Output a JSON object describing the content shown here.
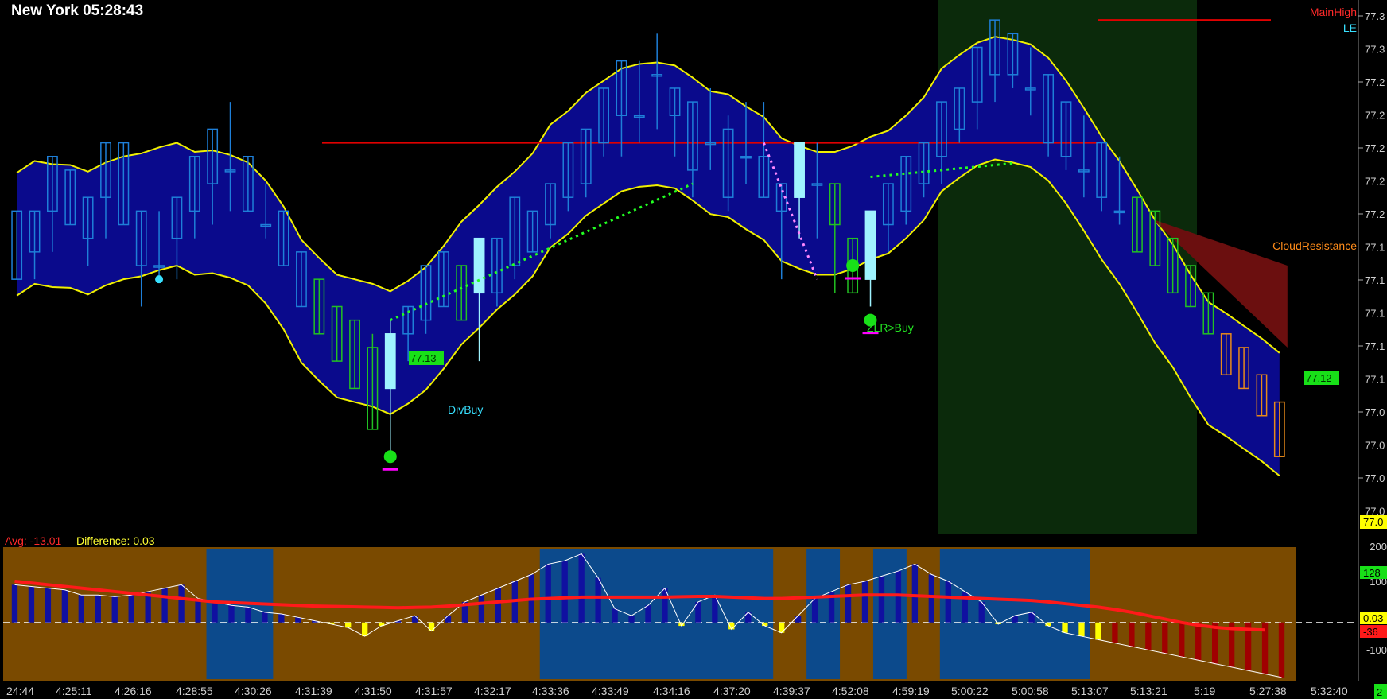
{
  "header": {
    "title": "New York 05:28:43"
  },
  "indicator_header": {
    "avg_label": "Avg: -13.01",
    "diff_label": "Difference: 0.03"
  },
  "colors": {
    "up_bar": "#1e7fd8",
    "down_bar": "#22c222",
    "signal_bar": "#9ff3ff",
    "orange_bar": "#e88a1a",
    "band": "#0a0a8c",
    "band_edge": "#f0f000",
    "resistance": "#e00000",
    "cloud": "#6b0f0f",
    "session": "#0b2a0b",
    "hist_orange": "#7a4a00",
    "hist_blue": "#0c4a8c"
  },
  "annotations": {
    "main_high": "MainHigh",
    "le": "LE",
    "cloud_resistance": "CloudResistance",
    "div_buy": "DivBuy",
    "zlr_buy": "ZLR>Buy",
    "price_tag_1": "77.13",
    "price_tag_2": "77.12"
  },
  "axis": {
    "price_ticks": [
      "77.3",
      "77.3",
      "77.2",
      "77.2",
      "77.2",
      "77.2",
      "77.2",
      "77.1",
      "77.1",
      "77.1",
      "77.1",
      "77.1",
      "77.0",
      "77.0",
      "77.0",
      "77.0"
    ],
    "current_price_label": "77.0",
    "indicator_ticks": [
      "200",
      "100",
      "-100"
    ],
    "indicator_value_labels": [
      "128",
      "0.03",
      "-36"
    ],
    "time_labels": [
      "24:44",
      "4:25:11",
      "4:26:16",
      "4:28:55",
      "4:30:26",
      "4:31:39",
      "4:31:50",
      "4:31:57",
      "4:32:17",
      "4:33:36",
      "4:33:49",
      "4:34:16",
      "4:37:20",
      "4:39:37",
      "4:52:08",
      "4:59:19",
      "5:00:22",
      "5:00:58",
      "5:13:07",
      "5:13:21",
      "5:19",
      "5:27:38",
      "5:32:40"
    ],
    "corner_label": "2"
  },
  "chart_data": [
    {
      "type": "bar",
      "title": "New York 05:28:43",
      "ylim": [
        76.98,
        77.36
      ],
      "bars": [
        {
          "open": 77.21,
          "high": 77.21,
          "low": 77.16,
          "close": 77.16,
          "color": "up"
        },
        {
          "open": 77.18,
          "high": 77.21,
          "low": 77.16,
          "close": 77.21,
          "color": "up"
        },
        {
          "open": 77.21,
          "high": 77.25,
          "low": 77.18,
          "close": 77.25,
          "color": "up"
        },
        {
          "open": 77.24,
          "high": 77.24,
          "low": 77.2,
          "close": 77.2,
          "color": "up"
        },
        {
          "open": 77.19,
          "high": 77.22,
          "low": 77.17,
          "close": 77.22,
          "color": "up"
        },
        {
          "open": 77.22,
          "high": 77.26,
          "low": 77.19,
          "close": 77.26,
          "color": "up"
        },
        {
          "open": 77.26,
          "high": 77.26,
          "low": 77.2,
          "close": 77.2,
          "color": "up"
        },
        {
          "open": 77.17,
          "high": 77.21,
          "low": 77.14,
          "close": 77.21,
          "color": "up"
        },
        {
          "open": 77.17,
          "high": 77.21,
          "low": 77.16,
          "close": 77.17,
          "color": "up"
        },
        {
          "open": 77.19,
          "high": 77.22,
          "low": 77.16,
          "close": 77.22,
          "color": "up"
        },
        {
          "open": 77.21,
          "high": 77.25,
          "low": 77.19,
          "close": 77.25,
          "color": "up"
        },
        {
          "open": 77.23,
          "high": 77.27,
          "low": 77.2,
          "close": 77.27,
          "color": "up"
        },
        {
          "open": 77.24,
          "high": 77.29,
          "low": 77.21,
          "close": 77.24,
          "color": "up"
        },
        {
          "open": 77.21,
          "high": 77.25,
          "low": 77.21,
          "close": 77.25,
          "color": "up"
        },
        {
          "open": 77.2,
          "high": 77.23,
          "low": 77.19,
          "close": 77.2,
          "color": "up"
        },
        {
          "open": 77.17,
          "high": 77.21,
          "low": 77.17,
          "close": 77.21,
          "color": "up"
        },
        {
          "open": 77.14,
          "high": 77.18,
          "low": 77.14,
          "close": 77.18,
          "color": "up"
        },
        {
          "open": 77.16,
          "high": 77.16,
          "low": 77.12,
          "close": 77.12,
          "color": "down"
        },
        {
          "open": 77.14,
          "high": 77.14,
          "low": 77.1,
          "close": 77.1,
          "color": "down"
        },
        {
          "open": 77.13,
          "high": 77.13,
          "low": 77.08,
          "close": 77.08,
          "color": "down"
        },
        {
          "open": 77.11,
          "high": 77.12,
          "low": 77.05,
          "close": 77.05,
          "color": "down"
        },
        {
          "open": 77.08,
          "high": 77.13,
          "low": 77.03,
          "close": 77.12,
          "color": "signal"
        },
        {
          "open": 77.12,
          "high": 77.14,
          "low": 77.1,
          "close": 77.14,
          "color": "up"
        },
        {
          "open": 77.13,
          "high": 77.17,
          "low": 77.12,
          "close": 77.17,
          "color": "up"
        },
        {
          "open": 77.14,
          "high": 77.18,
          "low": 77.14,
          "close": 77.18,
          "color": "up"
        },
        {
          "open": 77.17,
          "high": 77.17,
          "low": 77.13,
          "close": 77.13,
          "color": "down"
        },
        {
          "open": 77.15,
          "high": 77.19,
          "low": 77.1,
          "close": 77.19,
          "color": "signal"
        },
        {
          "open": 77.15,
          "high": 77.19,
          "low": 77.14,
          "close": 77.19,
          "color": "up"
        },
        {
          "open": 77.17,
          "high": 77.22,
          "low": 77.16,
          "close": 77.22,
          "color": "up"
        },
        {
          "open": 77.18,
          "high": 77.21,
          "low": 77.18,
          "close": 77.21,
          "color": "up"
        },
        {
          "open": 77.2,
          "high": 77.23,
          "low": 77.19,
          "close": 77.23,
          "color": "up"
        },
        {
          "open": 77.22,
          "high": 77.26,
          "low": 77.21,
          "close": 77.26,
          "color": "up"
        },
        {
          "open": 77.23,
          "high": 77.27,
          "low": 77.22,
          "close": 77.27,
          "color": "up"
        },
        {
          "open": 77.26,
          "high": 77.3,
          "low": 77.25,
          "close": 77.3,
          "color": "up"
        },
        {
          "open": 77.28,
          "high": 77.32,
          "low": 77.25,
          "close": 77.32,
          "color": "up"
        },
        {
          "open": 77.28,
          "high": 77.32,
          "low": 77.26,
          "close": 77.28,
          "color": "up"
        },
        {
          "open": 77.31,
          "high": 77.34,
          "low": 77.27,
          "close": 77.31,
          "color": "up"
        },
        {
          "open": 77.28,
          "high": 77.3,
          "low": 77.25,
          "close": 77.3,
          "color": "up"
        },
        {
          "open": 77.24,
          "high": 77.29,
          "low": 77.22,
          "close": 77.29,
          "color": "up"
        },
        {
          "open": 77.26,
          "high": 77.3,
          "low": 77.24,
          "close": 77.26,
          "color": "up"
        },
        {
          "open": 77.22,
          "high": 77.28,
          "low": 77.21,
          "close": 77.27,
          "color": "up"
        },
        {
          "open": 77.25,
          "high": 77.29,
          "low": 77.23,
          "close": 77.25,
          "color": "up"
        },
        {
          "open": 77.25,
          "high": 77.29,
          "low": 77.22,
          "close": 77.22,
          "color": "up"
        },
        {
          "open": 77.21,
          "high": 77.23,
          "low": 77.16,
          "close": 77.23,
          "color": "up"
        },
        {
          "open": 77.22,
          "high": 77.26,
          "low": 77.19,
          "close": 77.26,
          "color": "signal"
        },
        {
          "open": 77.23,
          "high": 77.26,
          "low": 77.19,
          "close": 77.23,
          "color": "up"
        },
        {
          "open": 77.2,
          "high": 77.23,
          "low": 77.15,
          "close": 77.23,
          "color": "down"
        },
        {
          "open": 77.19,
          "high": 77.19,
          "low": 77.15,
          "close": 77.15,
          "color": "down"
        },
        {
          "open": 77.16,
          "high": 77.21,
          "low": 77.14,
          "close": 77.21,
          "color": "signal"
        },
        {
          "open": 77.2,
          "high": 77.23,
          "low": 77.18,
          "close": 77.23,
          "color": "up"
        },
        {
          "open": 77.21,
          "high": 77.25,
          "low": 77.2,
          "close": 77.25,
          "color": "up"
        },
        {
          "open": 77.23,
          "high": 77.26,
          "low": 77.22,
          "close": 77.26,
          "color": "up"
        },
        {
          "open": 77.25,
          "high": 77.29,
          "low": 77.23,
          "close": 77.29,
          "color": "up"
        },
        {
          "open": 77.27,
          "high": 77.3,
          "low": 77.26,
          "close": 77.3,
          "color": "up"
        },
        {
          "open": 77.29,
          "high": 77.33,
          "low": 77.27,
          "close": 77.33,
          "color": "up"
        },
        {
          "open": 77.31,
          "high": 77.35,
          "low": 77.29,
          "close": 77.35,
          "color": "up"
        },
        {
          "open": 77.31,
          "high": 77.34,
          "low": 77.3,
          "close": 77.34,
          "color": "up"
        },
        {
          "open": 77.3,
          "high": 77.33,
          "low": 77.28,
          "close": 77.3,
          "color": "up"
        },
        {
          "open": 77.26,
          "high": 77.31,
          "low": 77.25,
          "close": 77.31,
          "color": "up"
        },
        {
          "open": 77.25,
          "high": 77.29,
          "low": 77.24,
          "close": 77.29,
          "color": "up"
        },
        {
          "open": 77.24,
          "high": 77.28,
          "low": 77.22,
          "close": 77.24,
          "color": "up"
        },
        {
          "open": 77.22,
          "high": 77.26,
          "low": 77.21,
          "close": 77.26,
          "color": "up"
        },
        {
          "open": 77.21,
          "high": 77.25,
          "low": 77.2,
          "close": 77.21,
          "color": "up"
        },
        {
          "open": 77.22,
          "high": 77.22,
          "low": 77.18,
          "close": 77.18,
          "color": "down"
        },
        {
          "open": 77.21,
          "high": 77.21,
          "low": 77.17,
          "close": 77.17,
          "color": "down"
        },
        {
          "open": 77.19,
          "high": 77.19,
          "low": 77.15,
          "close": 77.15,
          "color": "down"
        },
        {
          "open": 77.17,
          "high": 77.17,
          "low": 77.14,
          "close": 77.14,
          "color": "down"
        },
        {
          "open": 77.15,
          "high": 77.15,
          "low": 77.12,
          "close": 77.12,
          "color": "down"
        },
        {
          "open": 77.12,
          "high": 77.12,
          "low": 77.09,
          "close": 77.09,
          "color": "orange"
        },
        {
          "open": 77.11,
          "high": 77.11,
          "low": 77.08,
          "close": 77.08,
          "color": "orange"
        },
        {
          "open": 77.09,
          "high": 77.09,
          "low": 77.06,
          "close": 77.06,
          "color": "orange"
        },
        {
          "open": 77.07,
          "high": 77.07,
          "low": 77.03,
          "close": 77.03,
          "color": "orange"
        }
      ],
      "resistance_level": 77.26,
      "main_high_level": 77.35,
      "last_price": 77.0
    },
    {
      "type": "bar",
      "avg": -13.01,
      "difference": 0.03,
      "ylim": [
        -165,
        215
      ],
      "values": [
        110,
        105,
        100,
        95,
        80,
        80,
        75,
        80,
        90,
        100,
        110,
        70,
        60,
        50,
        45,
        30,
        25,
        15,
        5,
        -5,
        -15,
        -40,
        -10,
        5,
        20,
        -25,
        20,
        60,
        80,
        100,
        120,
        140,
        170,
        180,
        200,
        130,
        40,
        20,
        50,
        100,
        -10,
        60,
        80,
        -20,
        30,
        -10,
        -30,
        20,
        70,
        90,
        110,
        120,
        135,
        150,
        170,
        140,
        120,
        90,
        60,
        -5,
        20,
        30,
        -10,
        -30,
        -40,
        -50,
        -60,
        -70,
        -80,
        -90,
        -100,
        -110,
        -120,
        -130,
        -140,
        -150,
        -160
      ],
      "avg_line": [
        120,
        115,
        110,
        105,
        100,
        95,
        90,
        85,
        80,
        75,
        70,
        65,
        60,
        58,
        56,
        54,
        52,
        50,
        48,
        47,
        46,
        45,
        44,
        43,
        44,
        45,
        48,
        52,
        56,
        60,
        64,
        68,
        70,
        72,
        74,
        74,
        74,
        74,
        74,
        74,
        75,
        76,
        76,
        74,
        72,
        70,
        70,
        72,
        74,
        76,
        78,
        80,
        80,
        80,
        78,
        76,
        74,
        72,
        70,
        68,
        66,
        64,
        60,
        55,
        50,
        45,
        38,
        30,
        20,
        10,
        0,
        -8,
        -14,
        -18,
        -20,
        -22
      ]
    }
  ]
}
